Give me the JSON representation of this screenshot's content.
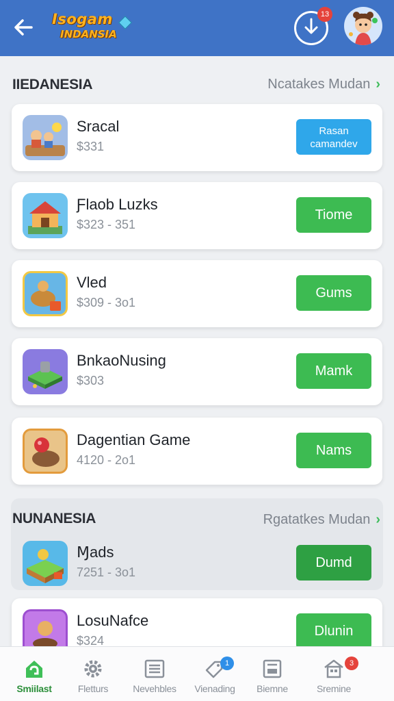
{
  "header": {
    "logo_line1": "Isogam",
    "logo_line2": "INDANSIA",
    "download_badge": "13"
  },
  "sections": [
    {
      "title": "IIEDANESIA",
      "link": "Ncatakes Mudan",
      "items": [
        {
          "name": "Sracal",
          "price": "$331",
          "action_line1": "Rasan",
          "action_line2": "camandev"
        },
        {
          "name": "Ƒlaob Luzks",
          "price": "$323 - 351",
          "action": "Tiome"
        },
        {
          "name": "Vled",
          "price": "$309 - 3o1",
          "action": "Gums"
        },
        {
          "name": "BnkaoNusing",
          "price": "$303",
          "action": "Mamk"
        },
        {
          "name": "Dagentian Game",
          "price": "4120 - 2o1",
          "action": "Nams"
        }
      ]
    },
    {
      "title": "NUNANESIA",
      "link": "Rgatatkes Mudan",
      "items": [
        {
          "name": "Ɱads",
          "price": "7251 - 3o1",
          "action": "Dumd"
        },
        {
          "name": "LosuNafce",
          "price": "$324",
          "action": "Dlunin"
        }
      ]
    }
  ],
  "bottom_nav": [
    {
      "label": "Smiilast",
      "icon": "home-icon",
      "active": true
    },
    {
      "label": "Fletturs",
      "icon": "gear-icon"
    },
    {
      "label": "Nevehbles",
      "icon": "newspaper-icon"
    },
    {
      "label": "Vienading",
      "icon": "tag-icon",
      "badge": "1"
    },
    {
      "label": "Biemne",
      "icon": "screen-icon"
    },
    {
      "label": "Sremine",
      "icon": "store-icon",
      "badge": "3"
    }
  ],
  "colors": {
    "header": "#3f73c6",
    "action_green": "#3dbb52",
    "action_blue": "#2fa7ea",
    "badge_red": "#e5433b",
    "badge_blue": "#2f8fe8",
    "active_nav": "#2c8f3a"
  }
}
